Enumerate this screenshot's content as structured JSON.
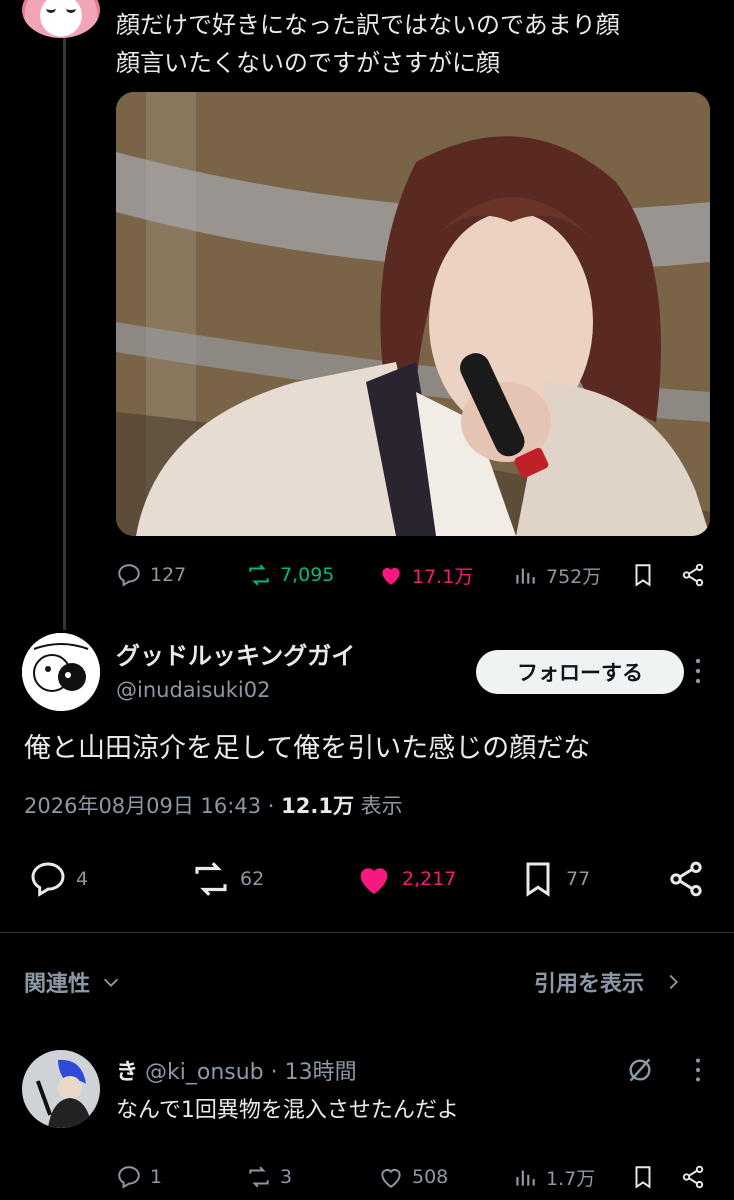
{
  "quoted_post": {
    "text_line1": "顔だけで好きになった訳ではないのであまり顔",
    "text_line2": "顔言いたくないのですがさすがに顔",
    "stats": {
      "replies": "127",
      "reposts": "7,095",
      "likes": "17.1万",
      "views": "752万"
    }
  },
  "main_post": {
    "display_name": "グッドルッキングガイ",
    "handle": "@inudaisuki02",
    "follow_label": "フォローする",
    "text": "俺と山田涼介を足して俺を引いた感じの顔だな",
    "timestamp": "2026年08月09日 16:43",
    "separator": "·",
    "views_count": "12.1万",
    "views_label": "表示",
    "stats": {
      "replies": "4",
      "reposts": "62",
      "likes": "2,217",
      "bookmarks": "77"
    }
  },
  "section": {
    "related_label": "関連性",
    "quotes_label": "引用を表示"
  },
  "reply": {
    "display_name": "き",
    "handle": "@ki_onsub",
    "separator": "·",
    "time": "13時間",
    "text": "なんで1回異物を混入させたんだよ",
    "stats": {
      "replies": "1",
      "reposts": "3",
      "likes": "508",
      "views": "1.7万"
    }
  },
  "colors": {
    "background": "#000000",
    "text": "#e7e9ea",
    "muted": "#8b98a5",
    "repost_green": "#00ba7c",
    "like_pink": "#f91880",
    "follow_button": "#eff3f4"
  },
  "icons": [
    "reply-icon",
    "repost-icon",
    "like-icon",
    "views-icon",
    "bookmark-icon",
    "share-icon",
    "more-icon",
    "chevron-down-icon",
    "chevron-right-icon",
    "grok-icon"
  ]
}
